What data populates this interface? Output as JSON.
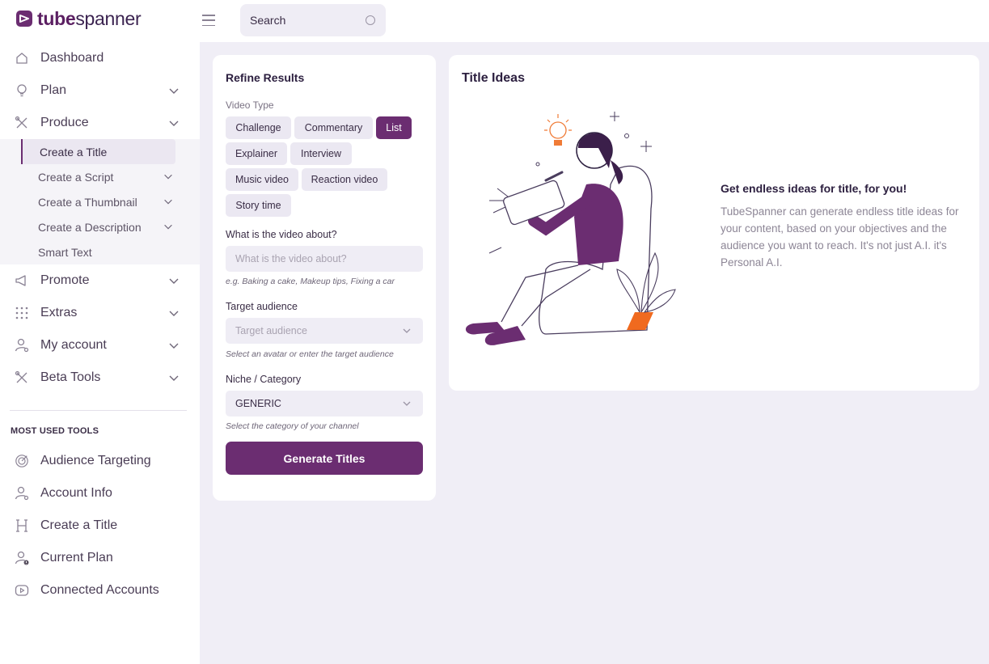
{
  "brand": {
    "tube": "tube",
    "spanner": "spanner",
    "color": "#6b2d71"
  },
  "topbar": {
    "search_placeholder": "Search"
  },
  "sidebar": {
    "items": [
      {
        "label": "Dashboard",
        "icon": "home-icon"
      },
      {
        "label": "Plan",
        "icon": "lightbulb-icon"
      },
      {
        "label": "Produce",
        "icon": "tools-icon"
      }
    ],
    "produce_sub": [
      {
        "label": "Create a Title",
        "active": true
      },
      {
        "label": "Create a Script"
      },
      {
        "label": "Create a Thumbnail"
      },
      {
        "label": "Create a Description"
      },
      {
        "label": "Smart Text"
      }
    ],
    "items_after": [
      {
        "label": "Promote",
        "icon": "megaphone-icon"
      },
      {
        "label": "Extras",
        "icon": "grid-dots-icon"
      },
      {
        "label": "My account",
        "icon": "user-gear-icon"
      },
      {
        "label": "Beta Tools",
        "icon": "tools-icon"
      }
    ],
    "most_used_heading": "MOST USED TOOLS",
    "tools": [
      {
        "label": "Audience Targeting",
        "icon": "target-icon"
      },
      {
        "label": "Account Info",
        "icon": "user-gear-icon"
      },
      {
        "label": "Create a Title",
        "icon": "heading-icon"
      },
      {
        "label": "Current Plan",
        "icon": "user-alert-icon"
      },
      {
        "label": "Connected Accounts",
        "icon": "video-icon"
      }
    ]
  },
  "refine": {
    "title": "Refine Results",
    "video_type_label": "Video Type",
    "video_types": [
      "Challenge",
      "Commentary",
      "List",
      "Explainer",
      "Interview",
      "Music video",
      "Reaction video",
      "Story time"
    ],
    "selected_type": "List",
    "about_label": "What is the video about?",
    "about_placeholder": "What is the video about?",
    "about_hint": "e.g. Baking a cake, Makeup tips, Fixing a car",
    "audience_label": "Target audience",
    "audience_placeholder": "Target audience",
    "audience_hint": "Select an avatar or enter the target audience",
    "niche_label": "Niche / Category",
    "niche_value": "GENERIC",
    "niche_hint": "Select the category of your channel",
    "generate_label": "Generate Titles"
  },
  "ideas": {
    "title": "Title Ideas",
    "promo_heading": "Get endless ideas for title, for you!",
    "promo_body": "TubeSpanner can generate endless title ideas for your content, based on your objectives and the audience you want to reach. It's not just A.I. it's Personal A.I."
  }
}
